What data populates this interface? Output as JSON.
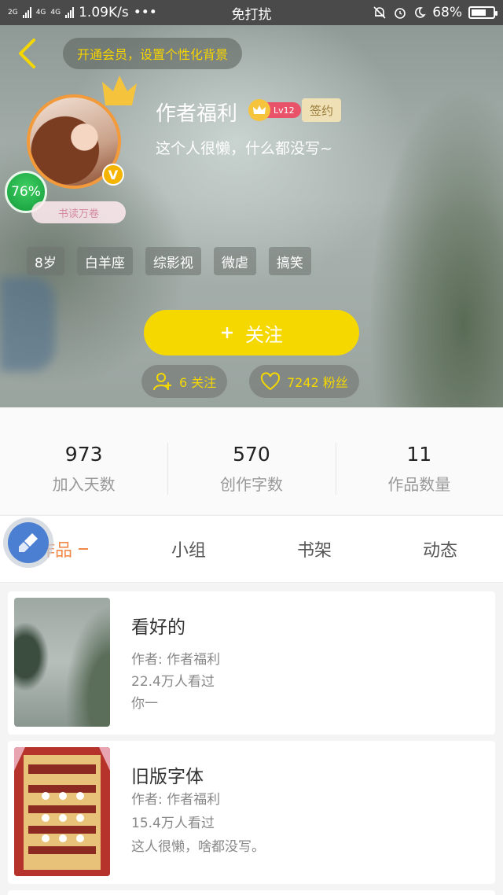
{
  "status_bar": {
    "network_a": "2G",
    "network_b": "4G",
    "network_c": "4G",
    "speed": "1.09K/s",
    "dots": "•••",
    "mode": "免打扰",
    "battery": "68%",
    "battery_level": 0.68
  },
  "header": {
    "vip_prompt": "开通会员，设置个性化背景",
    "name": "作者福利",
    "level": "Lv12",
    "sign_label": "签约",
    "bio": "这个人很懒，什么都没写~",
    "percent": "76%",
    "title_badge": "书读万卷",
    "tags": [
      "8岁",
      "白羊座",
      "综影视",
      "微虐",
      "搞笑"
    ],
    "follow_button": "关注",
    "following": "6 关注",
    "fans": "7242 粉丝"
  },
  "stats": [
    {
      "value": "973",
      "label": "加入天数"
    },
    {
      "value": "570",
      "label": "创作字数"
    },
    {
      "value": "11",
      "label": "作品数量"
    }
  ],
  "tabs": [
    "作品",
    "小组",
    "书架",
    "动态"
  ],
  "works": [
    {
      "title": "看好的",
      "author": "作者: 作者福利",
      "views": "22.4万人看过",
      "desc": "你一"
    },
    {
      "title": "旧版字体",
      "author": "作者: 作者福利",
      "views": "15.4万人看过",
      "desc": "这人很懒，啥都没写。"
    }
  ],
  "colors": {
    "accent_yellow": "#f5d800",
    "tab_active": "#f08a4b",
    "level_red": "#e9536a"
  }
}
